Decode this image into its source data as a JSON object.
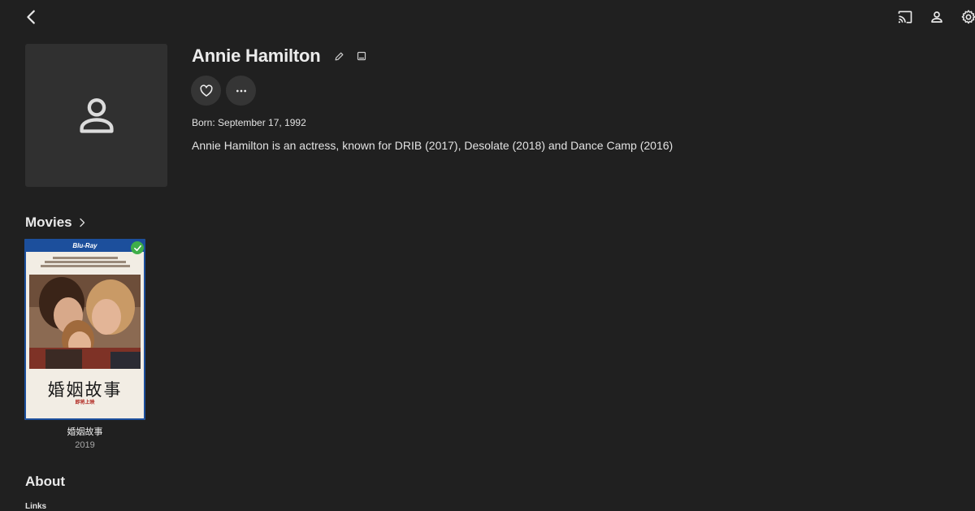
{
  "person": {
    "name": "Annie Hamilton",
    "born": "Born: September 17, 1992",
    "overview": "Annie Hamilton is an actress, known for DRIB (2017), Desolate (2018) and Dance Camp (2016)"
  },
  "sections": {
    "movies": "Movies",
    "about": "About",
    "links": "Links"
  },
  "movies": [
    {
      "title": "婚姻故事",
      "year": "2019",
      "played": true,
      "poster": {
        "band": "Blu-Ray",
        "title_cn": "婚姻故事",
        "release": "即将上映"
      }
    }
  ],
  "icons": {
    "back": "chevron-left-icon",
    "cast": "cast-icon",
    "user": "user-icon",
    "settings": "gear-icon",
    "edit": "pencil-icon",
    "image": "image-icon",
    "favorite": "heart-icon",
    "more": "more-horizontal-icon",
    "avatar": "person-placeholder-icon",
    "played": "check-icon"
  },
  "colors": {
    "background": "#202020",
    "card": "#303030",
    "button": "#353535",
    "played": "#3fae49",
    "text": "#ececec"
  }
}
